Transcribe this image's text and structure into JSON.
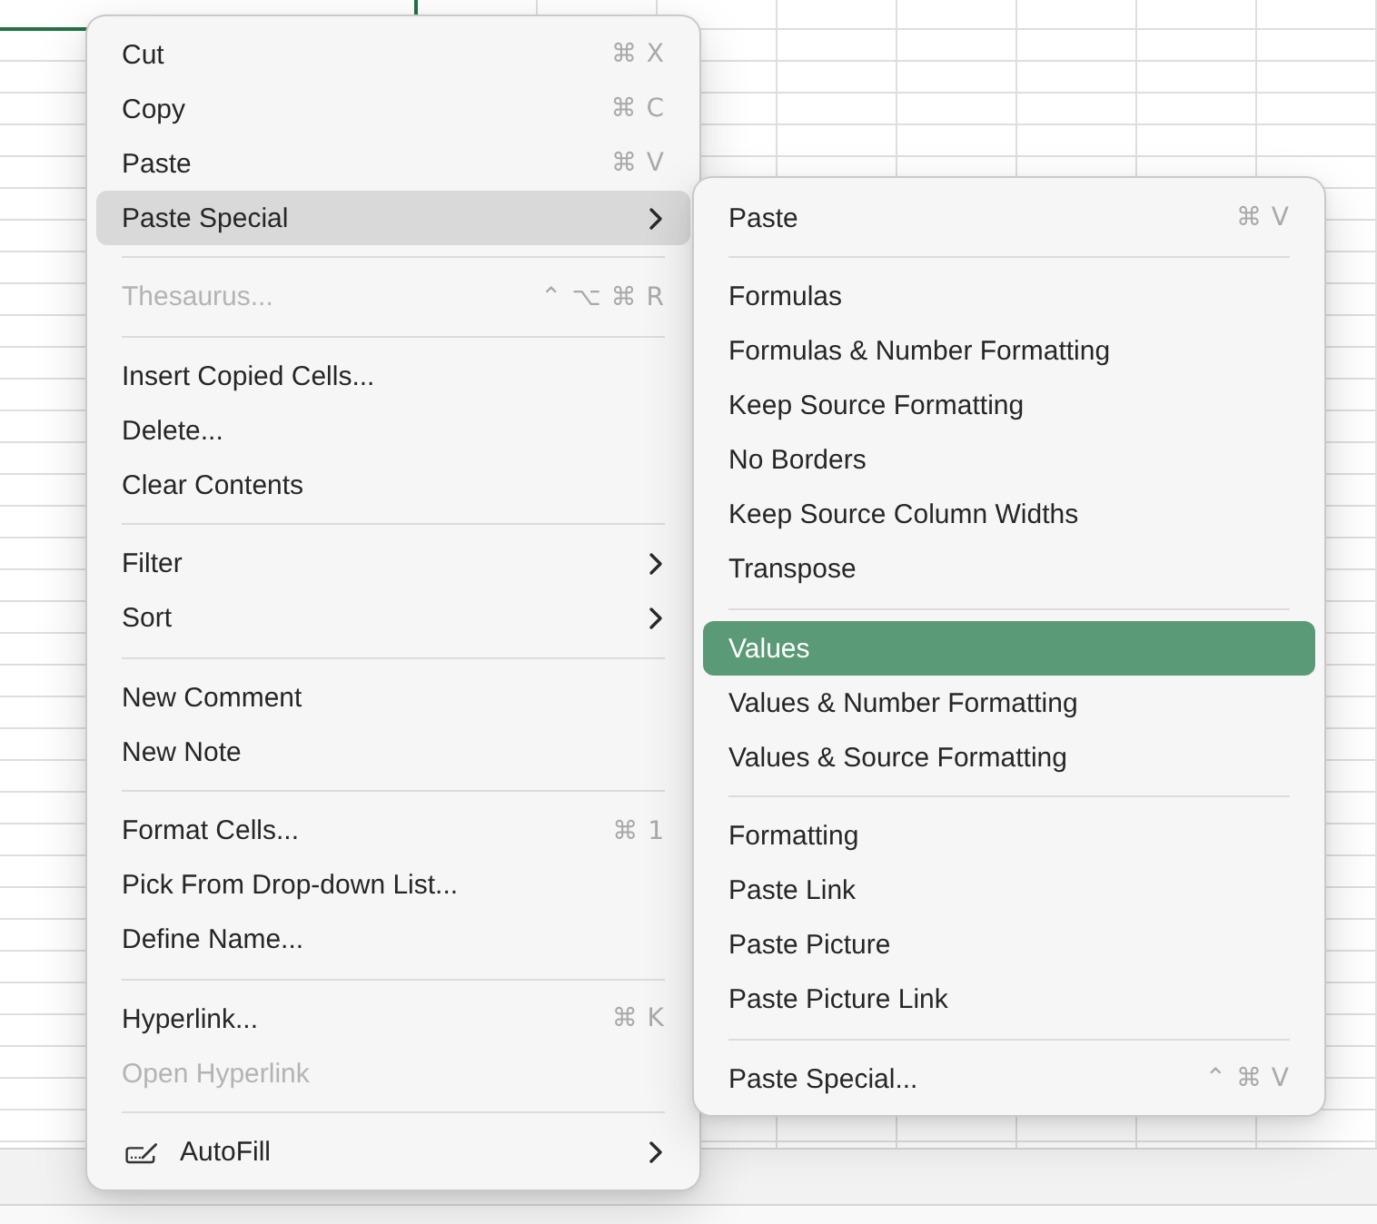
{
  "context_menu": {
    "sections": [
      {
        "items": [
          {
            "kind": "command",
            "label": "Cut",
            "shortcut": "⌘ X",
            "disabled": false,
            "selected": false
          },
          {
            "kind": "command",
            "label": "Copy",
            "shortcut": "⌘ C",
            "disabled": false,
            "selected": false
          },
          {
            "kind": "command",
            "label": "Paste",
            "shortcut": "⌘ V",
            "disabled": false,
            "selected": false
          },
          {
            "kind": "submenu",
            "label": "Paste Special",
            "expanded": true,
            "disabled": false,
            "selected": false
          }
        ]
      },
      {
        "items": [
          {
            "kind": "command",
            "label": "Thesaurus...",
            "shortcut": "⌃ ⌥ ⌘ R",
            "disabled": true,
            "selected": false
          }
        ]
      },
      {
        "items": [
          {
            "kind": "command",
            "label": "Insert Copied Cells...",
            "disabled": false,
            "selected": false
          },
          {
            "kind": "command",
            "label": "Delete...",
            "disabled": false,
            "selected": false
          },
          {
            "kind": "command",
            "label": "Clear Contents",
            "disabled": false,
            "selected": false
          }
        ]
      },
      {
        "items": [
          {
            "kind": "submenu",
            "label": "Filter",
            "expanded": false,
            "disabled": false,
            "selected": false
          },
          {
            "kind": "submenu",
            "label": "Sort",
            "expanded": false,
            "disabled": false,
            "selected": false
          }
        ]
      },
      {
        "items": [
          {
            "kind": "command",
            "label": "New Comment",
            "disabled": false,
            "selected": false
          },
          {
            "kind": "command",
            "label": "New Note",
            "disabled": false,
            "selected": false
          }
        ]
      },
      {
        "items": [
          {
            "kind": "command",
            "label": "Format Cells...",
            "shortcut": "⌘ 1",
            "disabled": false,
            "selected": false
          },
          {
            "kind": "command",
            "label": "Pick From Drop-down List...",
            "disabled": false,
            "selected": false
          },
          {
            "kind": "command",
            "label": "Define Name...",
            "disabled": false,
            "selected": false
          }
        ]
      },
      {
        "items": [
          {
            "kind": "command",
            "label": "Hyperlink...",
            "shortcut": "⌘ K",
            "disabled": false,
            "selected": false
          },
          {
            "kind": "command",
            "label": "Open Hyperlink",
            "disabled": true,
            "selected": false
          }
        ]
      },
      {
        "items": [
          {
            "kind": "tool",
            "label": "AutoFill",
            "expanded": false,
            "disabled": false,
            "selected": false
          }
        ]
      }
    ]
  },
  "submenu": {
    "sections": [
      {
        "items": [
          {
            "kind": "command",
            "label": "Paste",
            "shortcut": "⌘ V",
            "disabled": false,
            "selected": false
          }
        ]
      },
      {
        "items": [
          {
            "kind": "command",
            "label": "Formulas",
            "disabled": false,
            "selected": false
          },
          {
            "kind": "command",
            "label": "Formulas & Number Formatting",
            "disabled": false,
            "selected": false
          },
          {
            "kind": "command",
            "label": "Keep Source Formatting",
            "disabled": false,
            "selected": false
          },
          {
            "kind": "command",
            "label": "No Borders",
            "disabled": false,
            "selected": false
          },
          {
            "kind": "command",
            "label": "Keep Source Column Widths",
            "disabled": false,
            "selected": false
          },
          {
            "kind": "command",
            "label": "Transpose",
            "disabled": false,
            "selected": false
          }
        ]
      },
      {
        "items": [
          {
            "kind": "command",
            "label": "Values",
            "disabled": false,
            "selected": true
          },
          {
            "kind": "command",
            "label": "Values & Number Formatting",
            "disabled": false,
            "selected": false
          },
          {
            "kind": "command",
            "label": "Values & Source Formatting",
            "disabled": false,
            "selected": false
          }
        ]
      },
      {
        "items": [
          {
            "kind": "command",
            "label": "Formatting",
            "disabled": false,
            "selected": false
          },
          {
            "kind": "command",
            "label": "Paste Link",
            "disabled": false,
            "selected": false
          },
          {
            "kind": "command",
            "label": "Paste Picture",
            "disabled": false,
            "selected": false
          },
          {
            "kind": "command",
            "label": "Paste Picture Link",
            "disabled": false,
            "selected": false
          }
        ]
      },
      {
        "items": [
          {
            "kind": "command",
            "label": "Paste Special...",
            "shortcut": "⌃ ⌘ V",
            "disabled": false,
            "selected": false
          }
        ]
      }
    ]
  }
}
